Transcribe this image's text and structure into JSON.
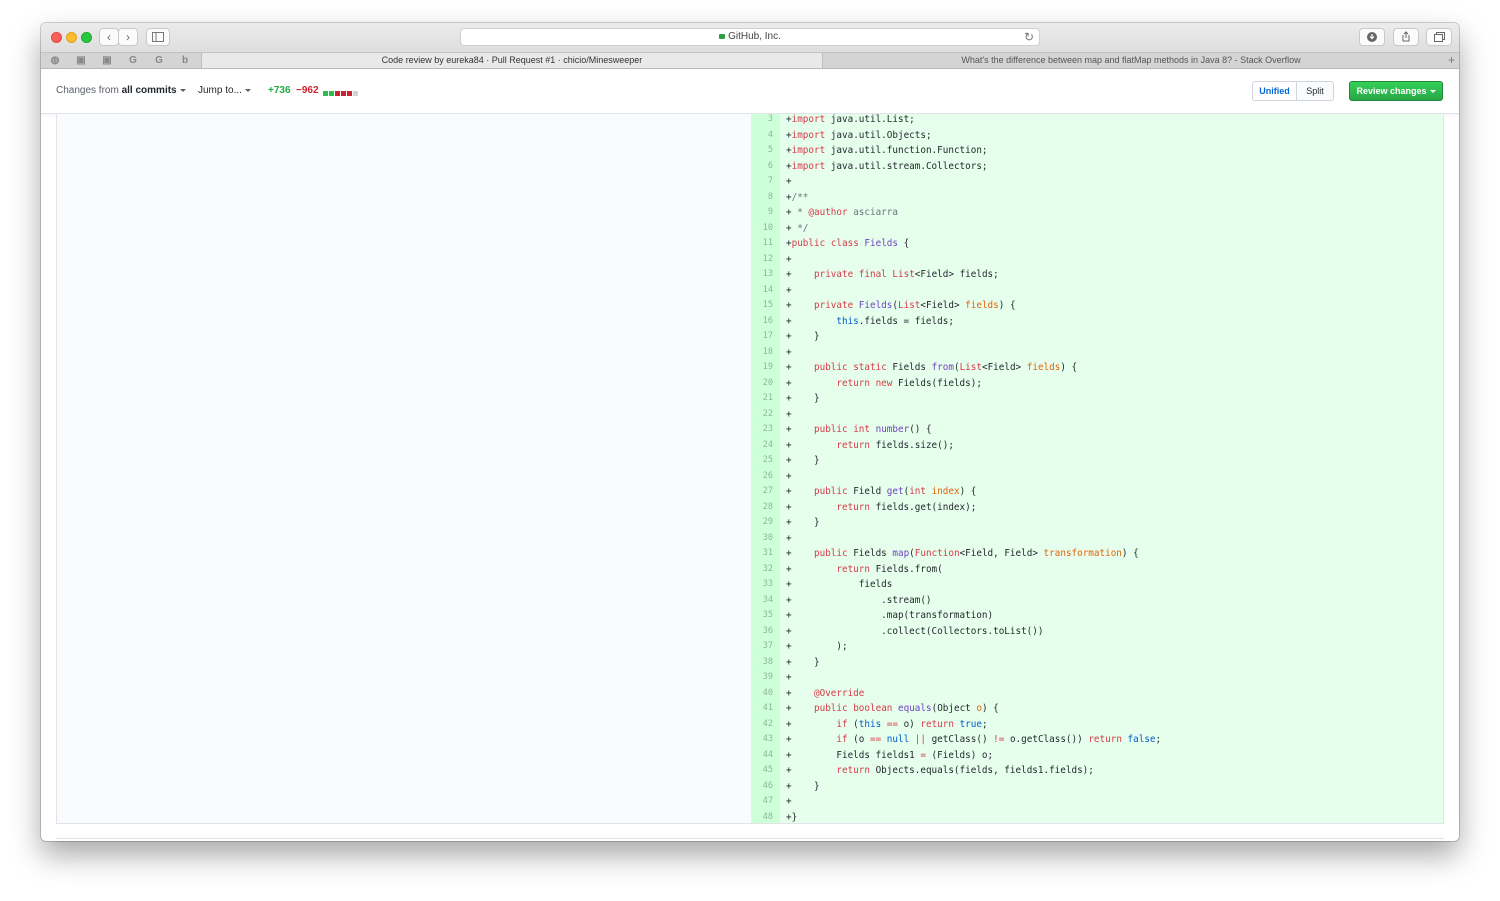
{
  "browser": {
    "address_text": "GitHub, Inc.",
    "tabs": [
      {
        "title": "Code review by eureka84 · Pull Request #1 · chicio/Minesweeper",
        "active": true
      },
      {
        "title": "What's the difference between map and flatMap methods in Java 8? - Stack Overflow",
        "active": false
      }
    ],
    "pinned_tabs": [
      "github-icon",
      "square-icon",
      "square-icon",
      "google-icon",
      "google-icon",
      "bing-icon"
    ]
  },
  "pr_toolbar": {
    "changes_prefix": "Changes from",
    "changes_value": "all commits",
    "jump_label": "Jump to...",
    "additions": "+736",
    "deletions": "−962",
    "diffstat": [
      "add",
      "add",
      "del",
      "del",
      "del"
    ],
    "view_unified": "Unified",
    "view_split": "Split",
    "review_button": "Review changes"
  },
  "diff": {
    "colors": {
      "add_bg": "#e6ffed",
      "add_gutter": "#cdffd8"
    },
    "lines": [
      {
        "n": 3,
        "tokens": [
          [
            "+",
            ""
          ],
          [
            "import",
            "k"
          ],
          [
            " java.util.List;",
            ""
          ]
        ]
      },
      {
        "n": 4,
        "tokens": [
          [
            "+",
            ""
          ],
          [
            "import",
            "k"
          ],
          [
            " java.util.Objects;",
            ""
          ]
        ]
      },
      {
        "n": 5,
        "tokens": [
          [
            "+",
            ""
          ],
          [
            "import",
            "k"
          ],
          [
            " java.util.function.Function;",
            ""
          ]
        ]
      },
      {
        "n": 6,
        "tokens": [
          [
            "+",
            ""
          ],
          [
            "import",
            "k"
          ],
          [
            " java.util.stream.Collectors;",
            ""
          ]
        ]
      },
      {
        "n": 7,
        "tokens": [
          [
            "+",
            ""
          ]
        ]
      },
      {
        "n": 8,
        "tokens": [
          [
            "+",
            ""
          ],
          [
            "/**",
            "cm"
          ]
        ]
      },
      {
        "n": 9,
        "tokens": [
          [
            "+",
            ""
          ],
          [
            " * ",
            "cm"
          ],
          [
            "@author",
            "k"
          ],
          [
            " asciarra",
            "cm"
          ]
        ]
      },
      {
        "n": 10,
        "tokens": [
          [
            "+",
            ""
          ],
          [
            " */",
            "cm"
          ]
        ]
      },
      {
        "n": 11,
        "tokens": [
          [
            "+",
            ""
          ],
          [
            "public",
            "k"
          ],
          [
            " ",
            ""
          ],
          [
            "class",
            "k"
          ],
          [
            " ",
            ""
          ],
          [
            "Fields",
            "e"
          ],
          [
            " {",
            ""
          ]
        ]
      },
      {
        "n": 12,
        "tokens": [
          [
            "+",
            ""
          ]
        ]
      },
      {
        "n": 13,
        "tokens": [
          [
            "+    ",
            ""
          ],
          [
            "private",
            "k"
          ],
          [
            " ",
            ""
          ],
          [
            "final",
            "k"
          ],
          [
            " ",
            ""
          ],
          [
            "List",
            "k"
          ],
          [
            "<Field> fields;",
            ""
          ]
        ]
      },
      {
        "n": 14,
        "tokens": [
          [
            "+",
            ""
          ]
        ]
      },
      {
        "n": 15,
        "tokens": [
          [
            "+    ",
            ""
          ],
          [
            "private",
            "k"
          ],
          [
            " ",
            ""
          ],
          [
            "Fields",
            "e"
          ],
          [
            "(",
            ""
          ],
          [
            "List",
            "k"
          ],
          [
            "<Field> ",
            ""
          ],
          [
            "fields",
            "v"
          ],
          [
            ") {",
            ""
          ]
        ]
      },
      {
        "n": 16,
        "tokens": [
          [
            "+        ",
            ""
          ],
          [
            "this",
            "c1"
          ],
          [
            ".fields = fields;",
            ""
          ]
        ]
      },
      {
        "n": 17,
        "tokens": [
          [
            "+    }",
            ""
          ]
        ]
      },
      {
        "n": 18,
        "tokens": [
          [
            "+",
            ""
          ]
        ]
      },
      {
        "n": 19,
        "tokens": [
          [
            "+    ",
            ""
          ],
          [
            "public",
            "k"
          ],
          [
            " ",
            ""
          ],
          [
            "static",
            "k"
          ],
          [
            " Fields ",
            ""
          ],
          [
            "from",
            "e"
          ],
          [
            "(",
            ""
          ],
          [
            "List",
            "k"
          ],
          [
            "<Field> ",
            ""
          ],
          [
            "fields",
            "v"
          ],
          [
            ") {",
            ""
          ]
        ]
      },
      {
        "n": 20,
        "tokens": [
          [
            "+        ",
            ""
          ],
          [
            "return",
            "k"
          ],
          [
            " ",
            ""
          ],
          [
            "new",
            "k"
          ],
          [
            " Fields(fields);",
            ""
          ]
        ]
      },
      {
        "n": 21,
        "tokens": [
          [
            "+    }",
            ""
          ]
        ]
      },
      {
        "n": 22,
        "tokens": [
          [
            "+",
            ""
          ]
        ]
      },
      {
        "n": 23,
        "tokens": [
          [
            "+    ",
            ""
          ],
          [
            "public",
            "k"
          ],
          [
            " ",
            ""
          ],
          [
            "int",
            "k"
          ],
          [
            " ",
            ""
          ],
          [
            "number",
            "e"
          ],
          [
            "() {",
            ""
          ]
        ]
      },
      {
        "n": 24,
        "tokens": [
          [
            "+        ",
            ""
          ],
          [
            "return",
            "k"
          ],
          [
            " fields.size();",
            ""
          ]
        ]
      },
      {
        "n": 25,
        "tokens": [
          [
            "+    }",
            ""
          ]
        ]
      },
      {
        "n": 26,
        "tokens": [
          [
            "+",
            ""
          ]
        ]
      },
      {
        "n": 27,
        "tokens": [
          [
            "+    ",
            ""
          ],
          [
            "public",
            "k"
          ],
          [
            " Field ",
            ""
          ],
          [
            "get",
            "e"
          ],
          [
            "(",
            ""
          ],
          [
            "int",
            "k"
          ],
          [
            " ",
            ""
          ],
          [
            "index",
            "v"
          ],
          [
            ") {",
            ""
          ]
        ]
      },
      {
        "n": 28,
        "tokens": [
          [
            "+        ",
            ""
          ],
          [
            "return",
            "k"
          ],
          [
            " fields.get(index);",
            ""
          ]
        ]
      },
      {
        "n": 29,
        "tokens": [
          [
            "+    }",
            ""
          ]
        ]
      },
      {
        "n": 30,
        "tokens": [
          [
            "+",
            ""
          ]
        ]
      },
      {
        "n": 31,
        "tokens": [
          [
            "+    ",
            ""
          ],
          [
            "public",
            "k"
          ],
          [
            " Fields ",
            ""
          ],
          [
            "map",
            "e"
          ],
          [
            "(",
            ""
          ],
          [
            "Function",
            "k"
          ],
          [
            "<Field, Field> ",
            ""
          ],
          [
            "transformation",
            "v"
          ],
          [
            ") {",
            ""
          ]
        ]
      },
      {
        "n": 32,
        "tokens": [
          [
            "+        ",
            ""
          ],
          [
            "return",
            "k"
          ],
          [
            " Fields.from(",
            ""
          ]
        ]
      },
      {
        "n": 33,
        "tokens": [
          [
            "+            fields",
            ""
          ]
        ]
      },
      {
        "n": 34,
        "tokens": [
          [
            "+                .stream()",
            ""
          ]
        ]
      },
      {
        "n": 35,
        "tokens": [
          [
            "+                .map(transformation)",
            ""
          ]
        ]
      },
      {
        "n": 36,
        "tokens": [
          [
            "+                .collect(Collectors.toList())",
            ""
          ]
        ]
      },
      {
        "n": 37,
        "tokens": [
          [
            "+        );",
            ""
          ]
        ]
      },
      {
        "n": 38,
        "tokens": [
          [
            "+    }",
            ""
          ]
        ]
      },
      {
        "n": 39,
        "tokens": [
          [
            "+",
            ""
          ]
        ]
      },
      {
        "n": 40,
        "tokens": [
          [
            "+    ",
            ""
          ],
          [
            "@Override",
            "k"
          ]
        ]
      },
      {
        "n": 41,
        "tokens": [
          [
            "+    ",
            ""
          ],
          [
            "public",
            "k"
          ],
          [
            " ",
            ""
          ],
          [
            "boolean",
            "k"
          ],
          [
            " ",
            ""
          ],
          [
            "equals",
            "e"
          ],
          [
            "(Object ",
            ""
          ],
          [
            "o",
            "v"
          ],
          [
            ") {",
            ""
          ]
        ]
      },
      {
        "n": 42,
        "tokens": [
          [
            "+        ",
            ""
          ],
          [
            "if",
            "k"
          ],
          [
            " (",
            ""
          ],
          [
            "this",
            "c1"
          ],
          [
            " ",
            ""
          ],
          [
            "==",
            "k"
          ],
          [
            " o) ",
            ""
          ],
          [
            "return",
            "k"
          ],
          [
            " ",
            ""
          ],
          [
            "true",
            "c1"
          ],
          [
            ";",
            ""
          ]
        ]
      },
      {
        "n": 43,
        "tokens": [
          [
            "+        ",
            ""
          ],
          [
            "if",
            "k"
          ],
          [
            " (o ",
            ""
          ],
          [
            "==",
            "k"
          ],
          [
            " ",
            ""
          ],
          [
            "null",
            "c1"
          ],
          [
            " ",
            ""
          ],
          [
            "||",
            "k"
          ],
          [
            " getClass() ",
            ""
          ],
          [
            "!=",
            "k"
          ],
          [
            " o.getClass()) ",
            ""
          ],
          [
            "return",
            "k"
          ],
          [
            " ",
            ""
          ],
          [
            "false",
            "c1"
          ],
          [
            ";",
            ""
          ]
        ]
      },
      {
        "n": 44,
        "tokens": [
          [
            "+        Fields fields1 ",
            ""
          ],
          [
            "=",
            "k"
          ],
          [
            " (Fields) o;",
            ""
          ]
        ]
      },
      {
        "n": 45,
        "tokens": [
          [
            "+        ",
            ""
          ],
          [
            "return",
            "k"
          ],
          [
            " Objects.equals(fields, fields1.fields);",
            ""
          ]
        ]
      },
      {
        "n": 46,
        "tokens": [
          [
            "+    }",
            ""
          ]
        ]
      },
      {
        "n": 47,
        "tokens": [
          [
            "+",
            ""
          ]
        ]
      },
      {
        "n": 48,
        "tokens": [
          [
            "+}",
            ""
          ]
        ]
      }
    ]
  }
}
